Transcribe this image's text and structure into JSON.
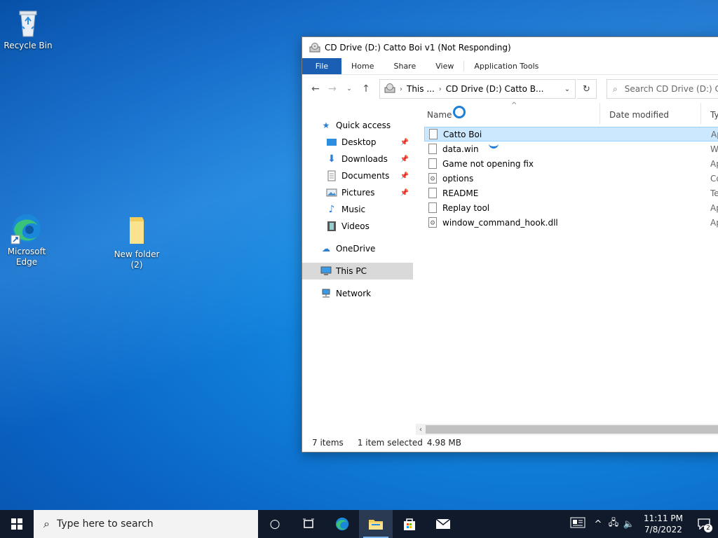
{
  "desktop": {
    "icons": [
      {
        "label": "Recycle Bin"
      },
      {
        "label": "Microsoft Edge"
      },
      {
        "label": "New folder (2)"
      }
    ]
  },
  "window": {
    "title": "CD Drive (D:) Catto Boi v1 (Not Responding)",
    "ribbon_tabs": [
      "File",
      "Home",
      "Share",
      "View",
      "Application Tools"
    ],
    "address": {
      "crumb1": "This ...",
      "crumb2": "CD Drive (D:) Catto B..."
    },
    "search_placeholder": "Search CD Drive (D:) Ca",
    "nav_pane": [
      {
        "label": "Quick access",
        "icon": "star-icon"
      },
      {
        "label": "Desktop",
        "icon": "desktop-icon",
        "pinned": true
      },
      {
        "label": "Downloads",
        "icon": "download-arrow-icon",
        "pinned": true
      },
      {
        "label": "Documents",
        "icon": "documents-icon",
        "pinned": true
      },
      {
        "label": "Pictures",
        "icon": "pictures-icon",
        "pinned": true
      },
      {
        "label": "Music",
        "icon": "music-note-icon"
      },
      {
        "label": "Videos",
        "icon": "film-icon"
      },
      {
        "label": "OneDrive",
        "icon": "cloud-icon"
      },
      {
        "label": "This PC",
        "icon": "monitor-icon",
        "selected": true
      },
      {
        "label": "Network",
        "icon": "network-icon"
      }
    ],
    "columns": {
      "name": "Name",
      "date": "Date modified",
      "type": "Ty"
    },
    "files": [
      {
        "name": "Catto Boi",
        "type": "Ap",
        "selected": true,
        "icon": "blank-file-icon"
      },
      {
        "name": "data.win",
        "type": "W",
        "icon": "blank-file-icon"
      },
      {
        "name": "Game not opening fix",
        "type": "Ap",
        "icon": "blank-file-icon"
      },
      {
        "name": "options",
        "type": "Co",
        "icon": "config-file-icon"
      },
      {
        "name": "README",
        "type": "Te",
        "icon": "text-file-icon"
      },
      {
        "name": "Replay tool",
        "type": "Ap",
        "icon": "blank-file-icon"
      },
      {
        "name": "window_command_hook.dll",
        "type": "Ap",
        "icon": "dll-file-icon"
      }
    ],
    "status": {
      "count": "7 items",
      "selection": "1 item selected",
      "size": "4.98 MB"
    }
  },
  "taskbar": {
    "search_placeholder": "Type here to search",
    "time": "11:11 PM",
    "date": "7/8/2022",
    "notification_count": "2"
  },
  "colors": {
    "file_tab": "#1a5fb4",
    "selection": "#cce8ff",
    "taskbar": "#101a2a",
    "accent": "#1e7fd9"
  }
}
